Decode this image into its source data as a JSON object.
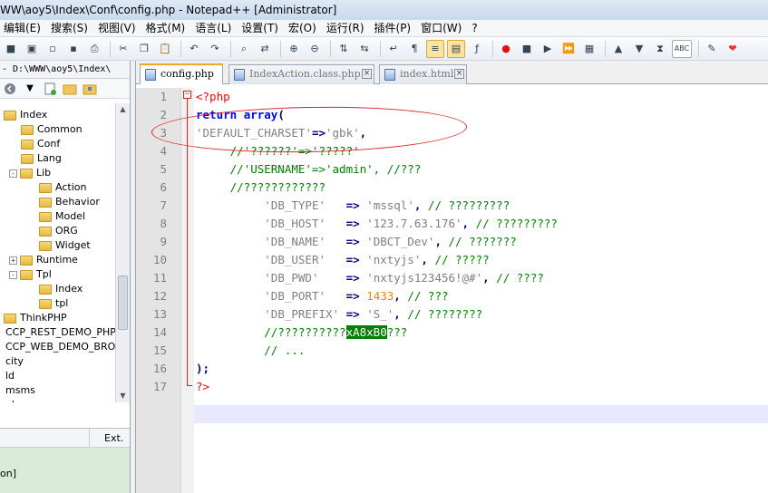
{
  "window": {
    "title": "WW\\aoy5\\Index\\Conf\\config.php - Notepad++ [Administrator]"
  },
  "menu": [
    "编辑(E)",
    "搜索(S)",
    "视图(V)",
    "格式(M)",
    "语言(L)",
    "设置(T)",
    "宏(O)",
    "运行(R)",
    "插件(P)",
    "窗口(W)",
    "?"
  ],
  "toolbar": {
    "icons": [
      "save-icon",
      "save-all-icon",
      "close-icon",
      "close-all-icon",
      "print-icon",
      "cut-icon",
      "copy-icon",
      "paste-icon",
      "undo-icon",
      "redo-icon",
      "find-icon",
      "replace-icon",
      "zoom-in-icon",
      "zoom-out-icon",
      "sync-v-icon",
      "sync-h-icon",
      "wrap-icon",
      "show-all-chars-icon",
      "indent-guide-icon",
      "doc-map-icon",
      "function-list-icon",
      "record-macro-icon",
      "stop-macro-icon",
      "play-macro-icon",
      "run-macro-multiple-icon",
      "save-macro-icon",
      "up-icon",
      "down-icon",
      "bookmark-icon",
      "spellcheck-icon",
      "highlight-icon",
      "heart-icon"
    ]
  },
  "explorer": {
    "path": "- D:\\WWW\\aoy5\\Index\\",
    "tree": [
      {
        "label": "Index",
        "depth": 0,
        "expander": ""
      },
      {
        "label": "Common",
        "depth": 1,
        "expander": ""
      },
      {
        "label": "Conf",
        "depth": 1,
        "expander": ""
      },
      {
        "label": "Lang",
        "depth": 1,
        "expander": ""
      },
      {
        "label": "Lib",
        "depth": 1,
        "expander": "-"
      },
      {
        "label": "Action",
        "depth": 2,
        "expander": ""
      },
      {
        "label": "Behavior",
        "depth": 2,
        "expander": ""
      },
      {
        "label": "Model",
        "depth": 2,
        "expander": ""
      },
      {
        "label": "ORG",
        "depth": 2,
        "expander": ""
      },
      {
        "label": "Widget",
        "depth": 2,
        "expander": ""
      },
      {
        "label": "Runtime",
        "depth": 1,
        "expander": "+"
      },
      {
        "label": "Tpl",
        "depth": 1,
        "expander": "-"
      },
      {
        "label": "Index",
        "depth": 2,
        "expander": ""
      },
      {
        "label": "tpl",
        "depth": 2,
        "expander": ""
      },
      {
        "label": "ThinkPHP",
        "depth": 0,
        "expander": ""
      },
      {
        "label": "CCP_REST_DEMO_PHP_",
        "depth": -1,
        "expander": ""
      },
      {
        "label": "CCP_WEB_DEMO_BROW",
        "depth": -1,
        "expander": ""
      },
      {
        "label": "city",
        "depth": -1,
        "expander": ""
      },
      {
        "label": "ld",
        "depth": -1,
        "expander": ""
      },
      {
        "label": "msms",
        "depth": -1,
        "expander": ""
      },
      {
        "label": "phpcms",
        "depth": -1,
        "expander": ""
      }
    ],
    "lower_header_ext": "Ext.",
    "lower_row": "on]"
  },
  "tabs": [
    {
      "label": "config.php",
      "active": true
    },
    {
      "label": "IndexAction.class.php",
      "active": false
    },
    {
      "label": "index.html",
      "active": false
    }
  ],
  "editor": {
    "line_numbers": [
      "1",
      "2",
      "3",
      "4",
      "5",
      "6",
      "7",
      "8",
      "9",
      "10",
      "11",
      "12",
      "13",
      "14",
      "15",
      "16",
      "17"
    ],
    "current_line": 16
  }
}
